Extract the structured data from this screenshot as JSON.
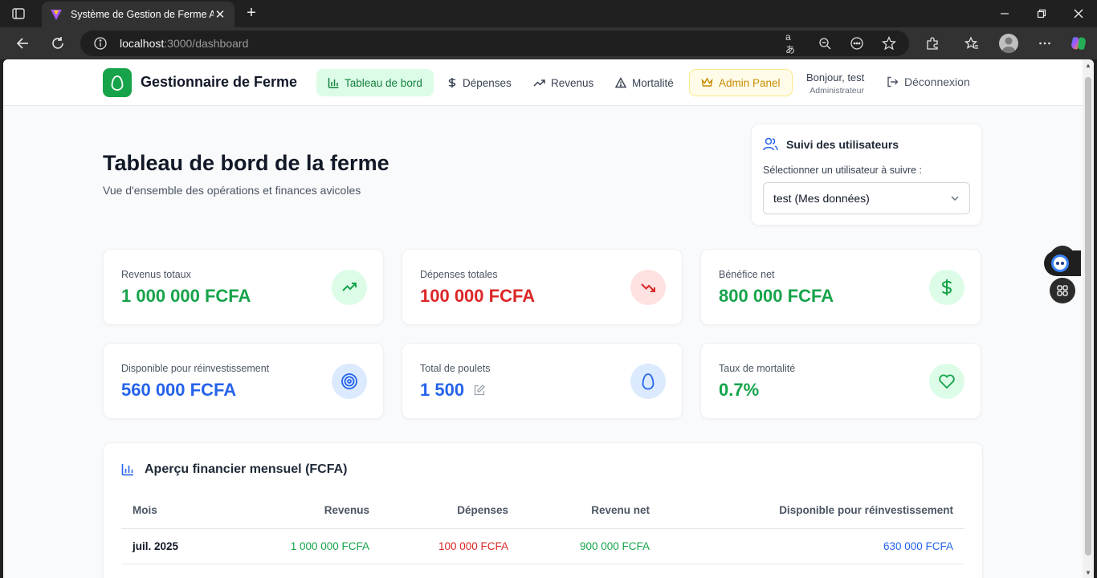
{
  "browser": {
    "tab_title": "Système de Gestion de Ferme Avi",
    "url_host": "localhost",
    "url_path": ":3000/dashboard"
  },
  "nav": {
    "brand": "Gestionnaire de Ferme",
    "items": [
      {
        "label": "Tableau de bord",
        "icon": "bar-chart-icon",
        "active": true
      },
      {
        "label": "Dépenses",
        "icon": "dollar-icon"
      },
      {
        "label": "Revenus",
        "icon": "trending-up-icon"
      },
      {
        "label": "Mortalité",
        "icon": "warning-icon"
      },
      {
        "label": "Admin Panel",
        "icon": "crown-icon"
      }
    ],
    "greeting": "Bonjour, test",
    "role": "Administrateur",
    "logout": "Déconnexion"
  },
  "header": {
    "title": "Tableau de bord de la ferme",
    "subtitle": "Vue d'ensemble des opérations et finances avicoles"
  },
  "tracker": {
    "title": "Suivi des utilisateurs",
    "label": "Sélectionner un utilisateur à suivre :",
    "selected": "test (Mes données)"
  },
  "stats": [
    {
      "label": "Revenus totaux",
      "value": "1 000 000 FCFA",
      "color": "#16a34a",
      "icon": "trending-up-icon"
    },
    {
      "label": "Dépenses totales",
      "value": "100 000 FCFA",
      "color": "#dc2626",
      "icon": "trending-down-icon"
    },
    {
      "label": "Bénéfice net",
      "value": "800 000 FCFA",
      "color": "#16a34a",
      "icon": "dollar-icon"
    },
    {
      "label": "Disponible pour réinvestissement",
      "value": "560 000 FCFA",
      "color": "#2563eb",
      "icon": "target-icon"
    },
    {
      "label": "Total de poulets",
      "value": "1 500",
      "color": "#2563eb",
      "icon": "egg-icon"
    },
    {
      "label": "Taux de mortalité",
      "value": "0.7%",
      "color": "#16a34a",
      "icon": "heart-icon"
    }
  ],
  "monthly": {
    "title": "Aperçu financier mensuel (FCFA)",
    "columns": [
      "Mois",
      "Revenus",
      "Dépenses",
      "Revenu net",
      "Disponible pour réinvestissement"
    ],
    "rows": [
      [
        "juil. 2025",
        "1 000 000 FCFA",
        "100 000 FCFA",
        "900 000 FCFA",
        "630 000 FCFA"
      ]
    ]
  }
}
